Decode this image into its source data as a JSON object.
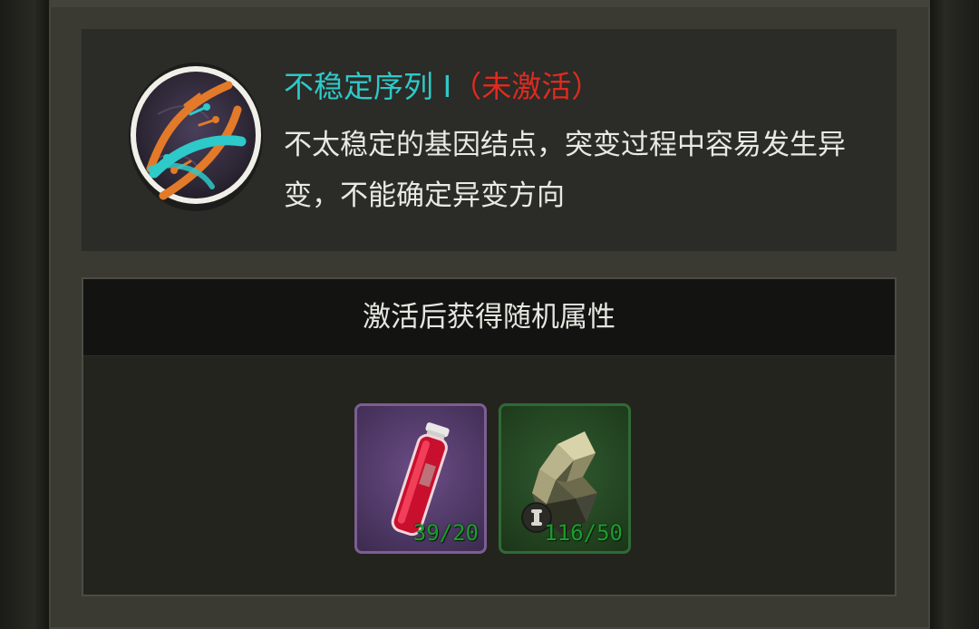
{
  "gene": {
    "name": "不稳定序列 I",
    "state": "（未激活）",
    "description": "不太稳定的基因结点，突变过程中容易发生异变，不能确定异变方向",
    "icon": "dna-helix-icon"
  },
  "attributes": {
    "title": "激活后获得随机属性"
  },
  "items": [
    {
      "icon": "red-vial-icon",
      "count": "39/20",
      "rarity_color": "#5a3f70"
    },
    {
      "icon": "ore-crystal-icon",
      "count": "116/50",
      "rarity_color": "#2a4d2a"
    }
  ],
  "colors": {
    "name": "#2ec9c9",
    "state": "#e02a1e",
    "count": "#1c9d2e"
  }
}
